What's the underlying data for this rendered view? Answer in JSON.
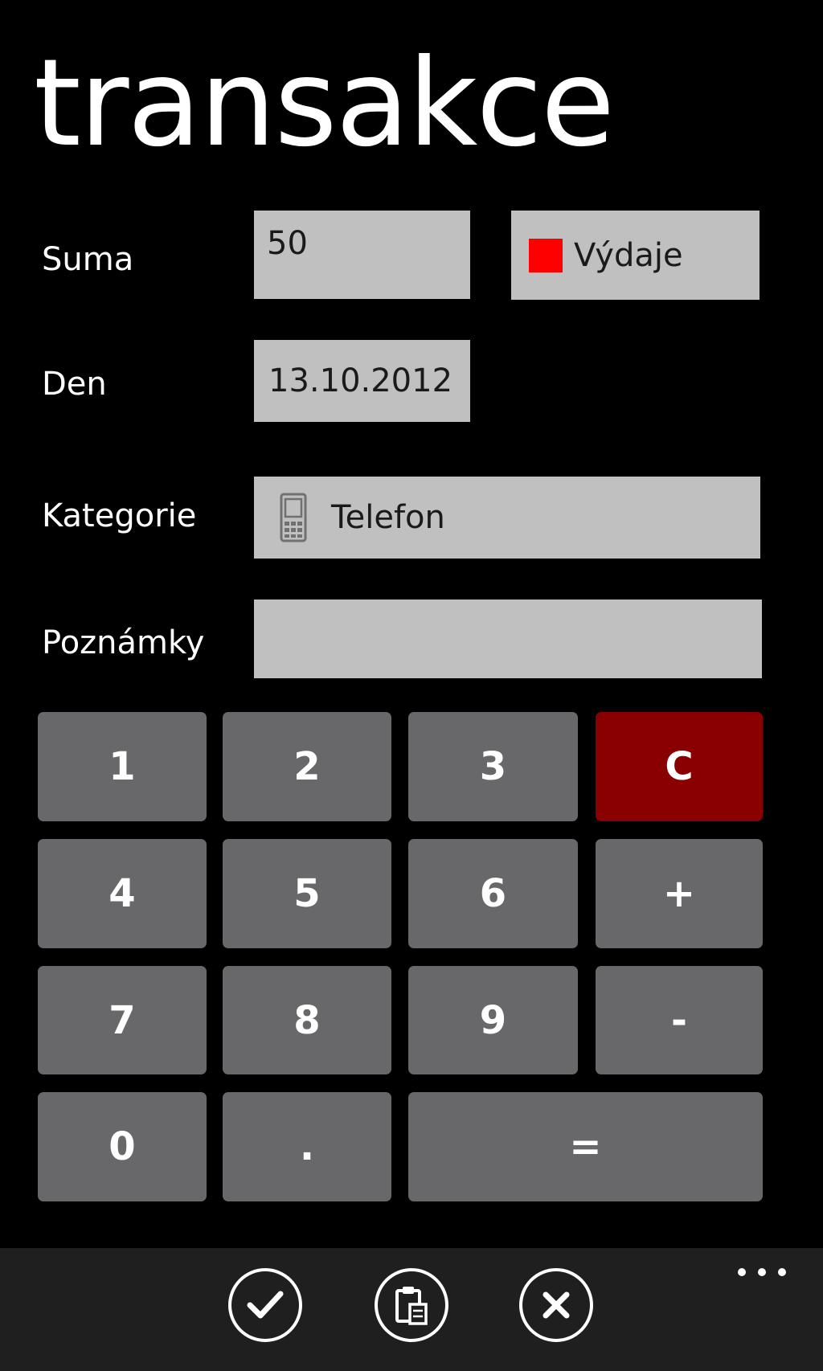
{
  "page": {
    "title": "transakce"
  },
  "form": {
    "suma": {
      "label": "Suma",
      "value": "50"
    },
    "type": {
      "label": "Výdaje",
      "color": "#ff0000"
    },
    "den": {
      "label": "Den",
      "value": "13.10.2012"
    },
    "kategorie": {
      "label": "Kategorie",
      "value": "Telefon",
      "icon": "phone-icon"
    },
    "poznamky": {
      "label": "Poznámky",
      "value": ""
    }
  },
  "keypad": {
    "k1": "1",
    "k2": "2",
    "k3": "3",
    "clear": "C",
    "k4": "4",
    "k5": "5",
    "k6": "6",
    "plus": "+",
    "k7": "7",
    "k8": "8",
    "k9": "9",
    "minus": "-",
    "k0": "0",
    "dot": ".",
    "equals": "=",
    "clear_color": "#8a0000",
    "key_color": "#686769"
  },
  "appbar": {
    "icons": [
      "check-icon",
      "clipboard-icon",
      "close-icon",
      "more-icon"
    ]
  }
}
